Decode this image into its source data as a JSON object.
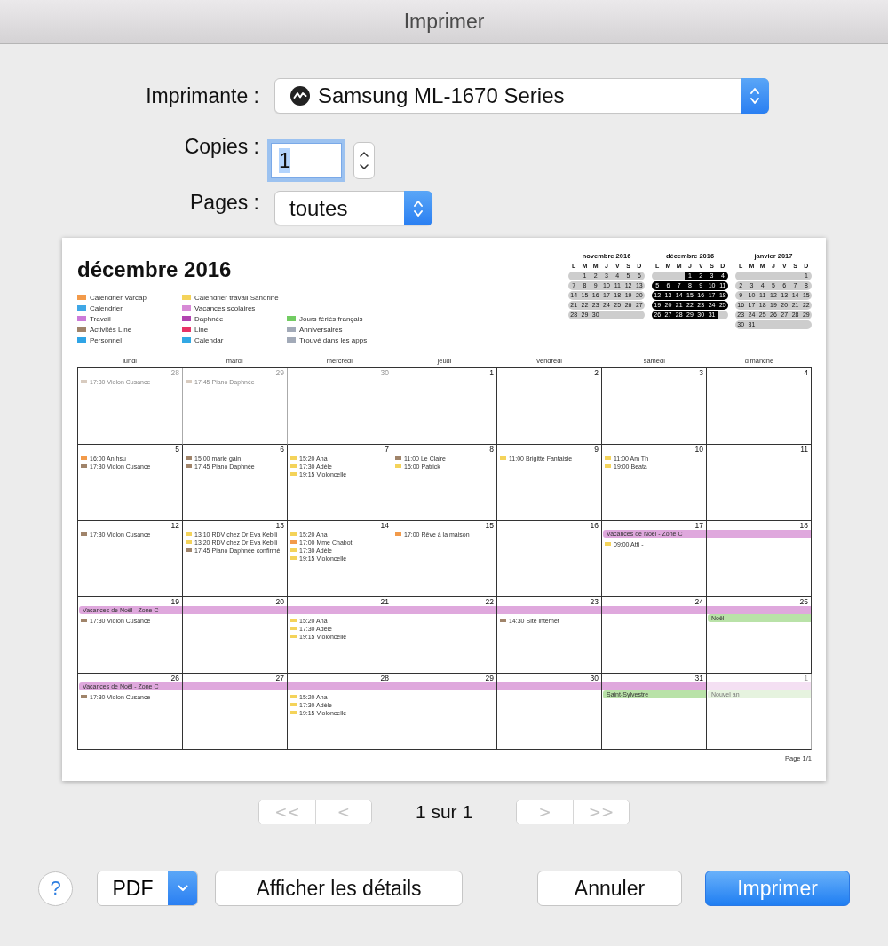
{
  "window": {
    "title": "Imprimer"
  },
  "printer": {
    "label": "Imprimante :",
    "value": "Samsung ML-1670 Series"
  },
  "copies": {
    "label": "Copies :",
    "value": "1",
    "focused": true
  },
  "pages": {
    "label": "Pages :",
    "value": "toutes"
  },
  "preview": {
    "title": "décembre 2016",
    "legend": [
      [
        {
          "label": "Calendrier Varcap",
          "color": "#f29a4a"
        },
        {
          "label": "Calendrier",
          "color": "#3fa7e6"
        },
        {
          "label": "Travail",
          "color": "#cc7ad9"
        },
        {
          "label": "Activités Line",
          "color": "#a0846a"
        },
        {
          "label": "Personnel",
          "color": "#2fa4e6"
        }
      ],
      [
        {
          "label": "Calendrier travail Sandrine",
          "color": "#f4d35a"
        },
        {
          "label": "Vacances scolaires",
          "color": "#d78ad6"
        },
        {
          "label": "Daphnée",
          "color": "#b144b0"
        },
        {
          "label": "Line",
          "color": "#e73366"
        },
        {
          "label": "Calendar",
          "color": "#32a8e4"
        }
      ],
      [
        {
          "label": "Jours fériés français",
          "color": "#72cc62"
        },
        {
          "label": "Anniversaires",
          "color": "#a2aab8"
        },
        {
          "label": "Trouvé dans les apps",
          "color": "#a2aab8"
        }
      ]
    ],
    "mini_months": [
      {
        "title": "novembre 2016",
        "selected": false,
        "weekdays": [
          "L",
          "M",
          "M",
          "J",
          "V",
          "S",
          "D"
        ],
        "weeks": [
          [
            "1",
            "2",
            "3",
            "4",
            "5",
            "6"
          ],
          [
            "7",
            "8",
            "9",
            "10",
            "11",
            "12",
            "13"
          ],
          [
            "14",
            "15",
            "16",
            "17",
            "18",
            "19",
            "20"
          ],
          [
            "21",
            "22",
            "23",
            "24",
            "25",
            "26",
            "27"
          ],
          [
            "28",
            "29",
            "30"
          ]
        ]
      },
      {
        "title": "décembre 2016",
        "selected": true,
        "weekdays": [
          "L",
          "M",
          "M",
          "J",
          "V",
          "S",
          "D"
        ],
        "weeks": [
          [
            "1",
            "2",
            "3",
            "4"
          ],
          [
            "5",
            "6",
            "7",
            "8",
            "9",
            "10",
            "11"
          ],
          [
            "12",
            "13",
            "14",
            "15",
            "16",
            "17",
            "18"
          ],
          [
            "19",
            "20",
            "21",
            "22",
            "23",
            "24",
            "25"
          ],
          [
            "26",
            "27",
            "28",
            "29",
            "30",
            "31"
          ]
        ]
      },
      {
        "title": "janvier 2017",
        "selected": false,
        "weekdays": [
          "L",
          "M",
          "M",
          "J",
          "V",
          "S",
          "D"
        ],
        "weeks": [
          [
            "1"
          ],
          [
            "2",
            "3",
            "4",
            "5",
            "6",
            "7",
            "8"
          ],
          [
            "9",
            "10",
            "11",
            "12",
            "13",
            "14",
            "15"
          ],
          [
            "16",
            "17",
            "18",
            "19",
            "20",
            "21",
            "22"
          ],
          [
            "23",
            "24",
            "25",
            "26",
            "27",
            "28",
            "29"
          ],
          [
            "30",
            "31"
          ]
        ]
      }
    ],
    "weekdays": [
      "lundi",
      "mardi",
      "mercredi",
      "jeudi",
      "vendredi",
      "samedi",
      "dimanche"
    ],
    "weeks": [
      [
        {
          "day": "28",
          "muted": true,
          "events": [
            {
              "text": "17:30 Violon Cusance",
              "color": "#d8cbbf"
            }
          ]
        },
        {
          "day": "29",
          "muted": true,
          "events": [
            {
              "text": "17:45 Piano Daphnée",
              "color": "#d8cbbf"
            }
          ]
        },
        {
          "day": "30",
          "muted": true
        },
        {
          "day": "1",
          "muted": false
        },
        {
          "day": "2",
          "muted": false
        },
        {
          "day": "3",
          "muted": false
        },
        {
          "day": "4",
          "muted": false
        }
      ],
      [
        {
          "day": "5",
          "muted": false,
          "events": [
            {
              "text": "16:00 An hsu",
              "color": "#f29a4a"
            },
            {
              "text": "17:30 Violon Cusance",
              "color": "#a0846a"
            }
          ]
        },
        {
          "day": "6",
          "muted": false,
          "events": [
            {
              "text": "15:00 marie gain",
              "color": "#a0846a"
            },
            {
              "text": "17:45 Piano Daphnée",
              "color": "#a0846a"
            }
          ]
        },
        {
          "day": "7",
          "muted": false,
          "events": [
            {
              "text": "15:20 Ana",
              "color": "#f4d35a"
            },
            {
              "text": "17:30 Adèle",
              "color": "#f4d35a"
            },
            {
              "text": "19:15 Violoncelle",
              "color": "#f4d35a"
            }
          ]
        },
        {
          "day": "8",
          "muted": false,
          "events": [
            {
              "text": "11:00 Le Claire",
              "color": "#a0846a"
            },
            {
              "text": "15:00 Patrick",
              "color": "#f4d35a"
            }
          ]
        },
        {
          "day": "9",
          "muted": false,
          "events": [
            {
              "text": "11:00 Brigitte Fantaisie",
              "color": "#f4d35a"
            }
          ]
        },
        {
          "day": "10",
          "muted": false,
          "events": [
            {
              "text": "11:00 Am Th",
              "color": "#f4d35a"
            },
            {
              "text": "19:00 Beata",
              "color": "#f4d35a"
            }
          ]
        },
        {
          "day": "11",
          "muted": false
        }
      ],
      [
        {
          "day": "12",
          "muted": false,
          "events": [
            {
              "text": "17:30 Violon Cusance",
              "color": "#a0846a"
            }
          ]
        },
        {
          "day": "13",
          "muted": false,
          "events": [
            {
              "text": "13:10 RDV chez Dr Eva Kebili",
              "color": "#f4d35a"
            },
            {
              "text": "13:20 RDV chez Dr Eva Kebili",
              "color": "#f4d35a"
            },
            {
              "text": "17:45 Piano Daphnée confirmé",
              "color": "#a0846a"
            }
          ]
        },
        {
          "day": "14",
          "muted": false,
          "events": [
            {
              "text": "15:20 Ana",
              "color": "#f4d35a"
            },
            {
              "text": "17:00 Mme Chabot",
              "color": "#f29a4a"
            },
            {
              "text": "17:30 Adèle",
              "color": "#f4d35a"
            },
            {
              "text": "19:15 Violoncelle",
              "color": "#f4d35a"
            }
          ]
        },
        {
          "day": "15",
          "muted": false,
          "events": [
            {
              "text": "17:00 Rêve à la maison",
              "color": "#f29a4a"
            }
          ]
        },
        {
          "day": "16",
          "muted": false
        },
        {
          "day": "17",
          "muted": false,
          "all_day": [
            {
              "label": "Vacances de Noël - Zone C",
              "color": "#dfa8dd"
            }
          ],
          "events": [
            {
              "text": "09:00 Atti -",
              "color": "#f4d35a"
            }
          ]
        },
        {
          "day": "18",
          "muted": false,
          "all_day": [
            {
              "kind": "continuation",
              "color": "#dfa8dd"
            }
          ]
        }
      ],
      [
        {
          "day": "19",
          "muted": false,
          "all_day": [
            {
              "label": "Vacances de Noël - Zone C",
              "color": "#dfa8dd"
            }
          ],
          "events": [
            {
              "text": "17:30 Violon Cusance",
              "color": "#a0846a"
            }
          ]
        },
        {
          "day": "20",
          "muted": false,
          "all_day": [
            {
              "kind": "continuation",
              "color": "#dfa8dd"
            }
          ]
        },
        {
          "day": "21",
          "muted": false,
          "all_day": [
            {
              "kind": "continuation",
              "color": "#dfa8dd"
            }
          ],
          "events": [
            {
              "text": "15:20 Ana",
              "color": "#f4d35a"
            },
            {
              "text": "17:30 Adèle",
              "color": "#f4d35a"
            },
            {
              "text": "19:15 Violoncelle",
              "color": "#f4d35a"
            }
          ]
        },
        {
          "day": "22",
          "muted": false,
          "all_day": [
            {
              "kind": "continuation",
              "color": "#dfa8dd"
            }
          ]
        },
        {
          "day": "23",
          "muted": false,
          "all_day": [
            {
              "kind": "continuation",
              "color": "#dfa8dd"
            }
          ],
          "events": [
            {
              "text": "14:30 Site internet",
              "color": "#a0846a"
            }
          ]
        },
        {
          "day": "24",
          "muted": false,
          "all_day": [
            {
              "kind": "continuation",
              "color": "#dfa8dd"
            }
          ]
        },
        {
          "day": "25",
          "muted": false,
          "all_day": [
            {
              "kind": "continuation",
              "color": "#dfa8dd"
            },
            {
              "label": "Noël",
              "color": "#b9e2a8"
            }
          ]
        }
      ],
      [
        {
          "day": "26",
          "muted": false,
          "all_day": [
            {
              "label": "Vacances de Noël - Zone C",
              "color": "#dfa8dd"
            }
          ],
          "events": [
            {
              "text": "17:30 Violon Cusance",
              "color": "#a0846a"
            }
          ]
        },
        {
          "day": "27",
          "muted": false,
          "all_day": [
            {
              "kind": "continuation",
              "color": "#dfa8dd"
            }
          ]
        },
        {
          "day": "28",
          "muted": false,
          "all_day": [
            {
              "kind": "continuation",
              "color": "#dfa8dd"
            }
          ],
          "events": [
            {
              "text": "15:20 Ana",
              "color": "#f4d35a"
            },
            {
              "text": "17:30 Adèle",
              "color": "#f4d35a"
            },
            {
              "text": "19:15 Violoncelle",
              "color": "#f4d35a"
            }
          ]
        },
        {
          "day": "29",
          "muted": false,
          "all_day": [
            {
              "kind": "continuation",
              "color": "#dfa8dd"
            }
          ]
        },
        {
          "day": "30",
          "muted": false,
          "all_day": [
            {
              "kind": "continuation",
              "color": "#dfa8dd"
            }
          ]
        },
        {
          "day": "31",
          "muted": false,
          "all_day": [
            {
              "kind": "continuation",
              "color": "#dfa8dd"
            },
            {
              "label": "Saint-Sylvestre",
              "color": "#b9e2a8"
            }
          ]
        },
        {
          "day": "1",
          "muted": true,
          "all_day": [
            {
              "kind": "continuation",
              "color": "#f4e0f3"
            },
            {
              "label": "Nouvel an",
              "color": "#e6f3df"
            }
          ]
        }
      ]
    ],
    "footer": "Page 1/1"
  },
  "pager": {
    "back": [
      {
        "label": "<<",
        "disabled": true
      },
      {
        "label": "<",
        "disabled": true
      }
    ],
    "status": "1 sur 1",
    "forward": [
      {
        "label": ">",
        "disabled": true
      },
      {
        "label": ">>",
        "disabled": true
      }
    ]
  },
  "bottom": {
    "help": "?",
    "pdf": "PDF",
    "details": "Afficher les détails",
    "buttons": [
      {
        "label": "Annuler",
        "default": false
      },
      {
        "label": "Imprimer",
        "default": true
      }
    ]
  }
}
